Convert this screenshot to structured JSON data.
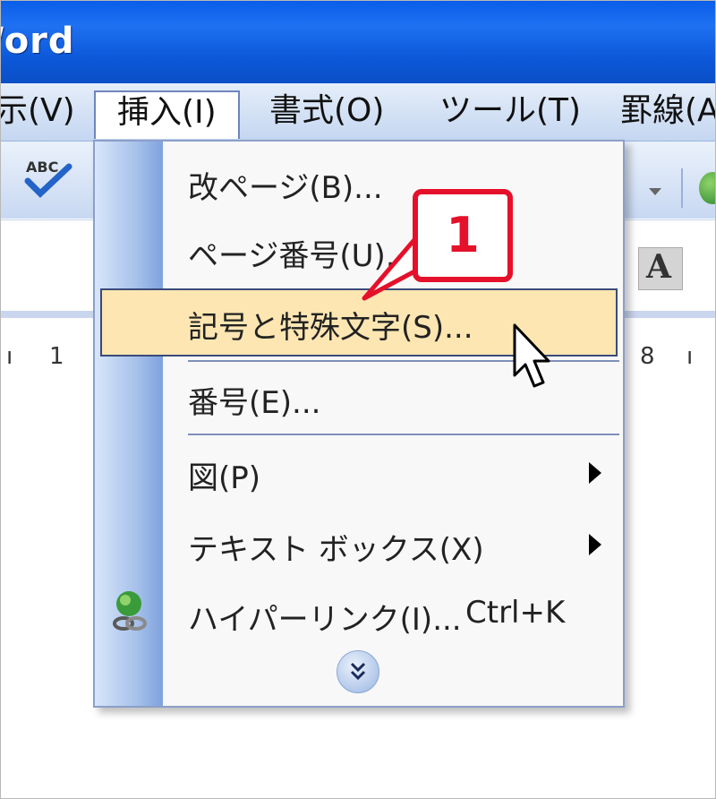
{
  "window": {
    "title": "Word"
  },
  "menubar": {
    "items": [
      {
        "label": "示(V)"
      },
      {
        "label": "挿入(I)"
      },
      {
        "label": "書式(O)"
      },
      {
        "label": "ツール(T)"
      },
      {
        "label": "罫線(A"
      }
    ]
  },
  "toolbar": {
    "spell_label": "ABC",
    "font_color_label": "A"
  },
  "ruler": {
    "left_mark": "1",
    "right_mark": "8"
  },
  "insert_menu": {
    "items": [
      {
        "label": "改ページ(B)..."
      },
      {
        "label": "ページ番号(U)..."
      },
      {
        "label": "記号と特殊文字(S)..."
      },
      {
        "label": "番号(E)..."
      },
      {
        "label": "図(P)"
      },
      {
        "label": "テキスト ボックス(X)"
      },
      {
        "label": "ハイパーリンク(I)...",
        "shortcut": "Ctrl+K"
      }
    ]
  },
  "callout": {
    "number": "1",
    "color": "#e5102a"
  },
  "colors": {
    "titlebar": "#0a5ee8",
    "highlight": "#fde6b2",
    "gutter": "#a8c2ea"
  }
}
